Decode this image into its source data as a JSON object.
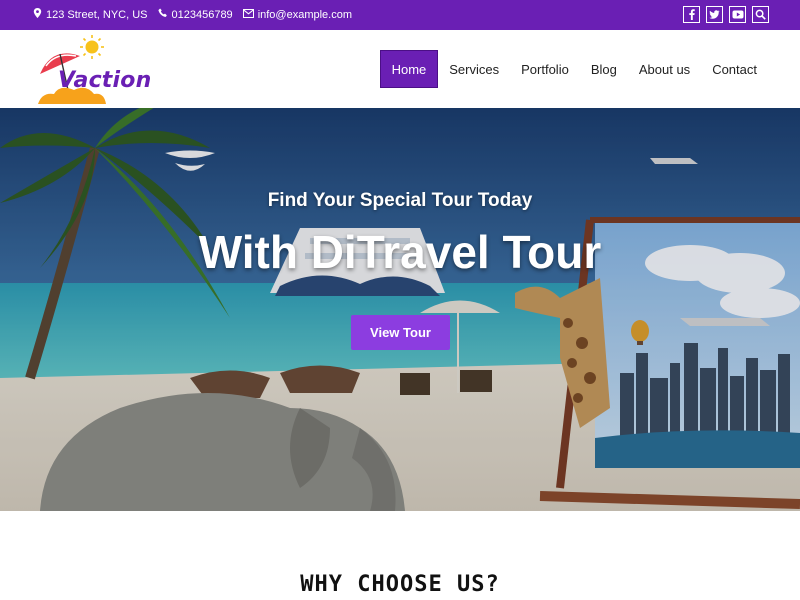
{
  "topbar": {
    "address": "123 Street, NYC, US",
    "phone": "0123456789",
    "email": "info@example.com",
    "social": [
      "facebook-icon",
      "twitter-icon",
      "youtube-icon",
      "search-icon"
    ]
  },
  "header": {
    "logo_text": "Vaction",
    "nav": [
      {
        "label": "Home",
        "active": true
      },
      {
        "label": "Services"
      },
      {
        "label": "Portfolio"
      },
      {
        "label": "Blog"
      },
      {
        "label": "About us"
      },
      {
        "label": "Contact"
      }
    ]
  },
  "hero": {
    "subtitle": "Find Your Special Tour Today",
    "title": "With DiTravel Tour",
    "cta": "View Tour"
  },
  "section": {
    "title": "WHY CHOOSE US?"
  },
  "colors": {
    "brand": "#6a1fb4",
    "cta": "#8c3de0"
  }
}
